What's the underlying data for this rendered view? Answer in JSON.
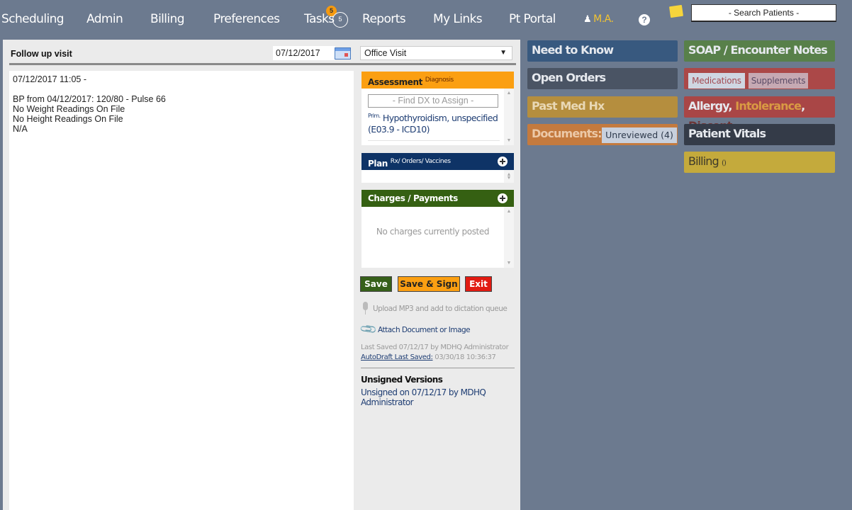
{
  "nav": {
    "items": [
      "Scheduling",
      "Admin",
      "Billing",
      "Preferences",
      "Tasks",
      "Reports",
      "My Links",
      "Pt Portal"
    ],
    "tasks_badge": "5",
    "tasks_count": "5",
    "user": "M.A.",
    "help": "?",
    "search_placeholder": "- Search Patients -"
  },
  "encounter": {
    "title": "Follow up visit",
    "date": "07/12/2017",
    "visit_type": "Office Visit",
    "note_lines": [
      "07/12/2017 11:05 -",
      "",
      "BP from 04/12/2017: 120/80 - Pulse 66",
      "No Weight Readings On File",
      "No Height Readings On File",
      "N/A"
    ]
  },
  "assessment": {
    "title": "Assessment",
    "subtitle": "Diagnosis",
    "find_placeholder": "- Find DX to Assign -",
    "dx_prefix": "Prim.",
    "dx_text": "Hypothyroidism, unspecified (E03.9 - ICD10)",
    "color": "#fb9f12"
  },
  "plan": {
    "title": "Plan",
    "subtitle": "Rx/ Orders/ Vaccines",
    "color": "#0e3366"
  },
  "charges": {
    "title": "Charges / Payments",
    "empty_text": "No charges currently posted",
    "color": "#356012"
  },
  "actions": {
    "save": "Save",
    "save_sign": "Save & Sign",
    "exit": "Exit"
  },
  "utilities": {
    "upload": "Upload MP3 and add to dictation queue",
    "attach": "Attach Document or Image",
    "last_saved": "Last Saved 07/12/17 by MDHQ Administrator",
    "autodraft_label": "AutoDraft Last Saved:",
    "autodraft_time": "03/30/18 10:36:37",
    "unsigned_title": "Unsigned Versions",
    "unsigned_link": "Unsigned on 07/12/17 by MDHQ Administrator"
  },
  "tiles": {
    "need_to_know": "Need to Know",
    "open_orders": "Open Orders",
    "past_med_hx": "Past Med Hx",
    "documents": "Documents:",
    "documents_badge": "Unreviewed (4)",
    "soap": "SOAP / Encounter Notes",
    "medications": "Medications",
    "supplements": "Supplements",
    "allergy": "Allergy,",
    "intolerance": "Intolerance",
    "comma": ",",
    "discont": "Discont.",
    "patient_vitals": "Patient Vitals",
    "billing": "Billing",
    "billing_count": "()",
    "colors": {
      "need_to_know": "#38597f",
      "open_orders": "#4a5464",
      "past_med_hx": "#b58e3e",
      "documents": "#c47a3e",
      "soap": "#58804a",
      "medications": "#ab4848",
      "allergy": "#a94646",
      "patient_vitals": "#343b48",
      "billing": "#c4aa3c"
    }
  }
}
